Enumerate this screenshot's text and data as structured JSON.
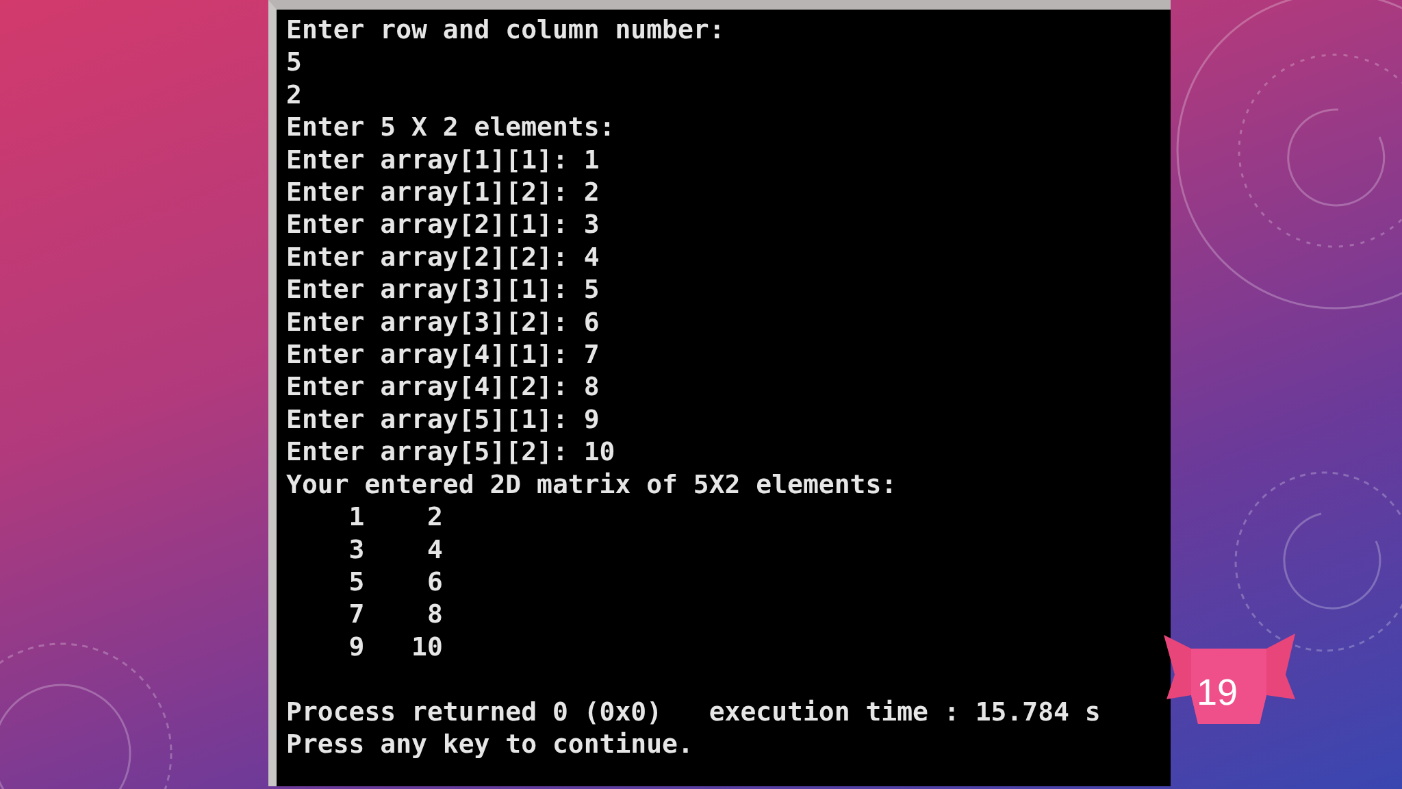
{
  "console": {
    "lines": [
      "Enter row and column number:",
      "5",
      "2",
      "Enter 5 X 2 elements:",
      "Enter array[1][1]: 1",
      "Enter array[1][2]: 2",
      "Enter array[2][1]: 3",
      "Enter array[2][2]: 4",
      "Enter array[3][1]: 5",
      "Enter array[3][2]: 6",
      "Enter array[4][1]: 7",
      "Enter array[4][2]: 8",
      "Enter array[5][1]: 9",
      "Enter array[5][2]: 10",
      "Your entered 2D matrix of 5X2 elements:",
      "    1    2",
      "    3    4",
      "    5    6",
      "    7    8",
      "    9   10"
    ],
    "footer_lines": [
      "Process returned 0 (0x0)   execution time : 15.784 s",
      "Press any key to continue."
    ]
  },
  "slide_number": "19"
}
